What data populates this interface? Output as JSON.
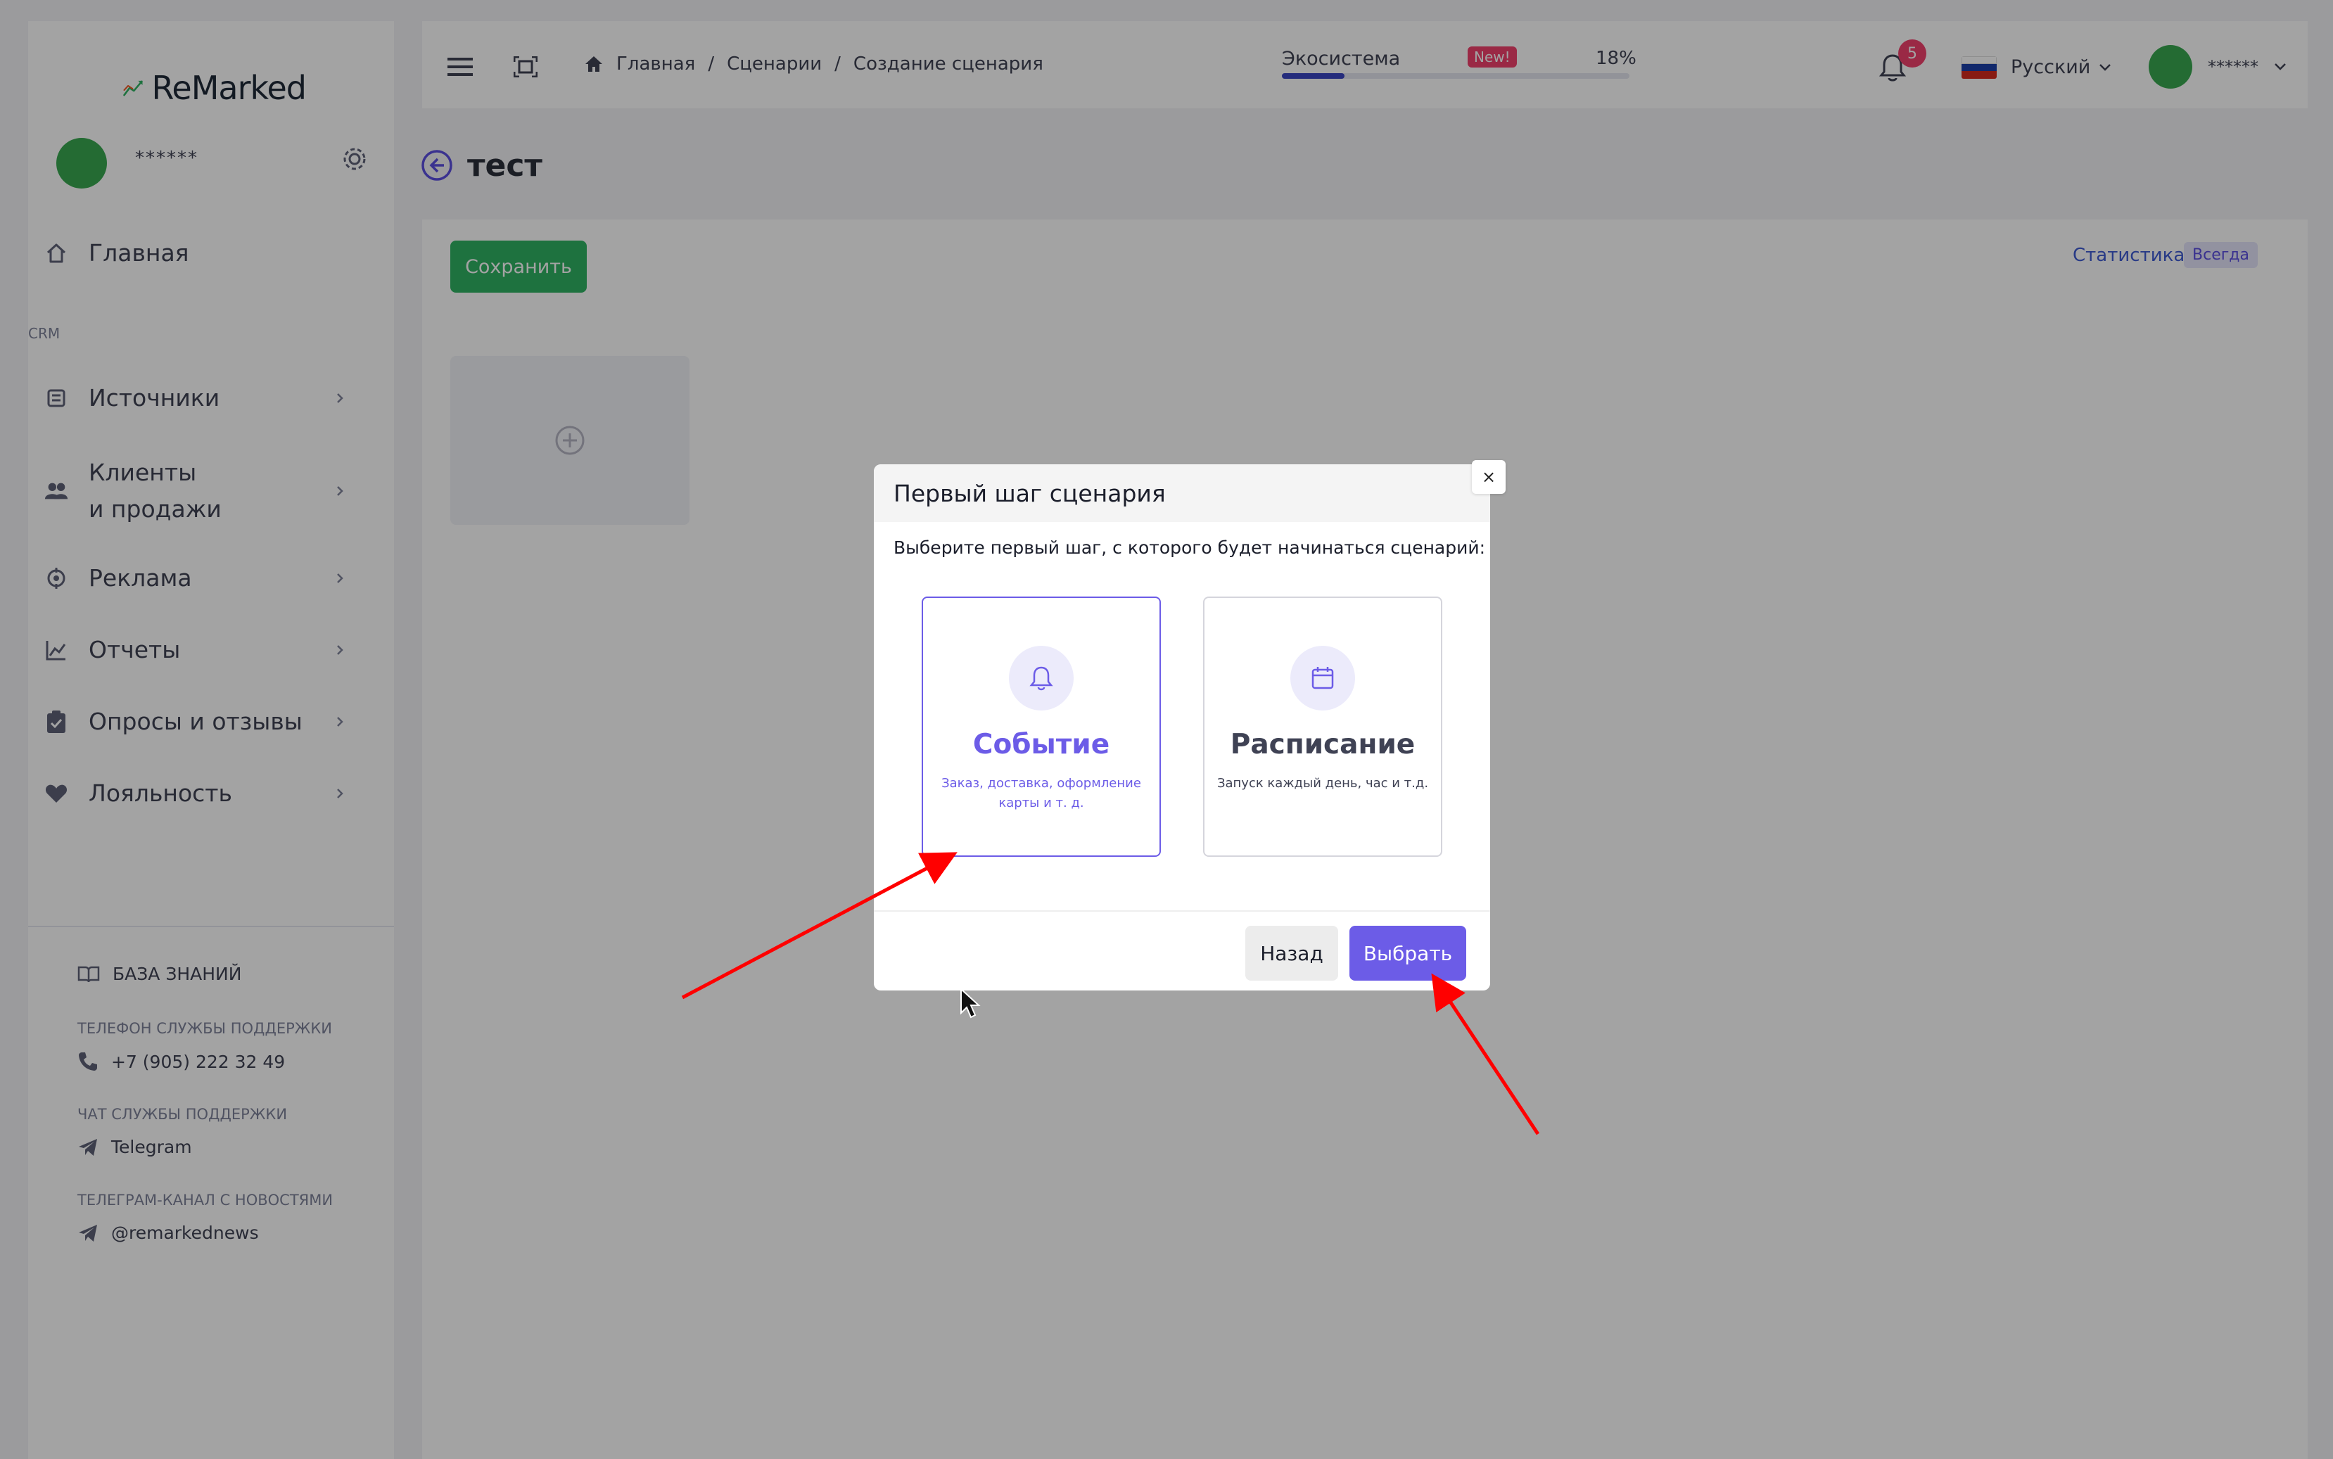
{
  "sidebar": {
    "logo_text": "ReMarked",
    "username": "******",
    "crm_label": "CRM",
    "items": [
      {
        "label": "Главная"
      },
      {
        "label": "Источники"
      },
      {
        "label": "Клиенты",
        "label2": "и продажи"
      },
      {
        "label": "Реклама"
      },
      {
        "label": "Отчеты"
      },
      {
        "label": "Опросы и отзывы"
      },
      {
        "label": "Лояльность"
      }
    ],
    "knowledge_base": "БАЗА ЗНАНИЙ",
    "support_phone_label": "ТЕЛЕФОН СЛУЖБЫ ПОДДЕРЖКИ",
    "support_phone": "+7 (905) 222 32 49",
    "support_chat_label": "ЧАТ СЛУЖБЫ ПОДДЕРЖКИ",
    "support_chat": "Telegram",
    "news_channel_label": "ТЕЛЕГРАМ-КАНАЛ С НОВОСТЯМИ",
    "news_channel": "@remarkednews"
  },
  "header": {
    "breadcrumb": [
      "Главная",
      "Сценарии",
      "Создание сценария"
    ],
    "breadcrumb_sep": "/",
    "ecosystem_label": "Экосистема",
    "new_badge": "New!",
    "progress_percent": "18%",
    "progress_value": 0.18,
    "notifications_count": "5",
    "language": "Русский",
    "username": "******"
  },
  "page": {
    "title": "тест",
    "save_button": "Сохранить",
    "stats_link": "Статистика",
    "always_badge": "Всегда"
  },
  "modal": {
    "title": "Первый шаг сценария",
    "close_glyph": "×",
    "subtitle": "Выберите первый шаг, с которого будет начинаться сценарий:",
    "options": [
      {
        "title": "Событие",
        "description": "Заказ, доставка, оформление карты и т. д.",
        "icon": "bell-icon"
      },
      {
        "title": "Расписание",
        "description": "Запуск каждый день, час и т.д.",
        "icon": "calendar-icon"
      }
    ],
    "back_button": "Назад",
    "choose_button": "Выбрать"
  },
  "colors": {
    "accent": "#6c5ce7",
    "save_green": "#2fb363",
    "badge_red": "#f1416c",
    "annotation_arrow": "#ff0000"
  }
}
